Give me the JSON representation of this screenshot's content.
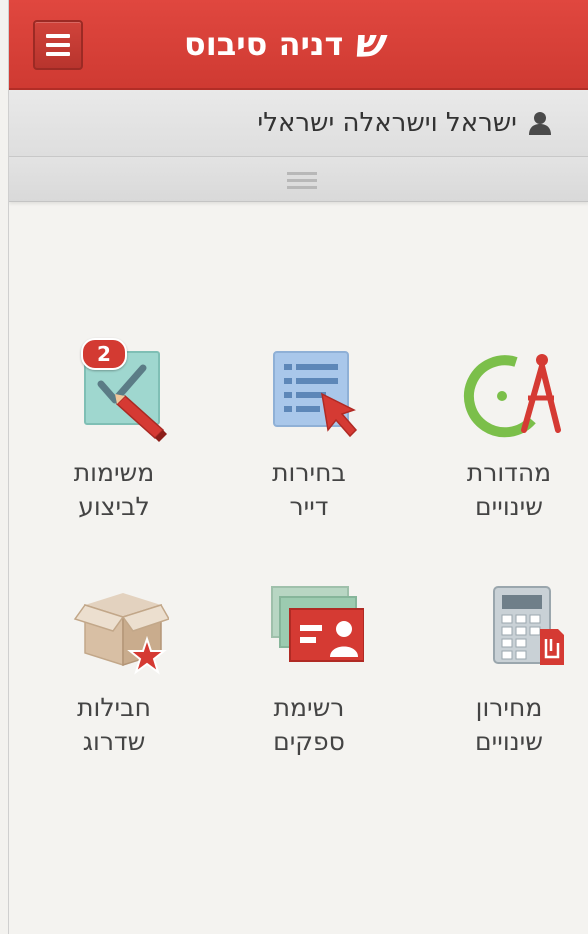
{
  "header": {
    "logo_mark": "ש",
    "brand_name": "דניה סיבוס"
  },
  "user": {
    "name": "ישראל וישראלה ישראלי"
  },
  "tiles": [
    {
      "label_line1": "מהדורת",
      "label_line2": "שינויים",
      "icon": "compass-icon"
    },
    {
      "label_line1": "בחירות",
      "label_line2": "דייר",
      "icon": "list-cursor-icon"
    },
    {
      "label_line1": "משימות",
      "label_line2": "לביצוע",
      "icon": "checklist-pencil-icon",
      "badge": "2"
    },
    {
      "label_line1": "מחירון",
      "label_line2": "שינויים",
      "icon": "calculator-icon"
    },
    {
      "label_line1": "רשימת",
      "label_line2": "ספקים",
      "icon": "contact-cards-icon"
    },
    {
      "label_line1": "חבילות",
      "label_line2": "שדרוג",
      "icon": "box-star-icon"
    }
  ],
  "colors": {
    "header_red": "#d8423a",
    "badge_red": "#d33a32",
    "text_gray": "#444444"
  }
}
